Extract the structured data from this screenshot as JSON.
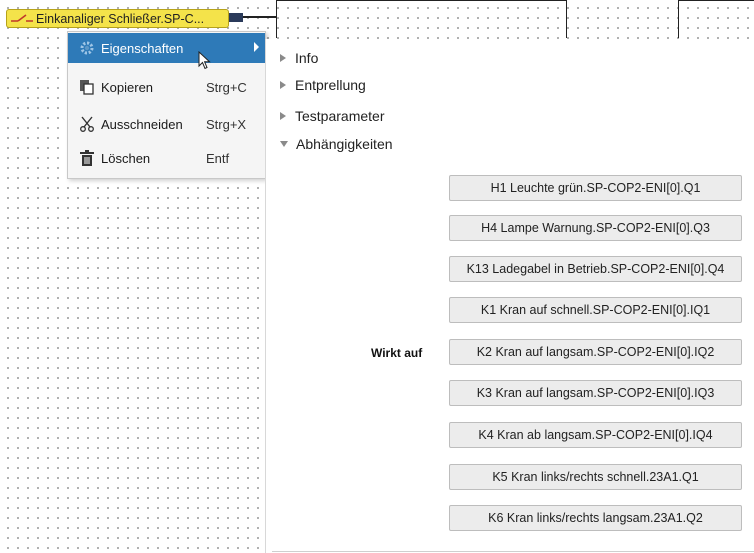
{
  "canvas": {
    "block_label": "Einkanaliger Schließer.SP-C...",
    "block_color": "#f4e34a"
  },
  "context_menu": {
    "items": [
      {
        "label": "Eigenschaften",
        "shortcut": "",
        "icon": "gear-icon",
        "highlighted": true,
        "submenu": true
      },
      {
        "label": "Kopieren",
        "shortcut": "Strg+C",
        "icon": "copy-icon"
      },
      {
        "label": "Ausschneiden",
        "shortcut": "Strg+X",
        "icon": "scissors-icon"
      },
      {
        "label": "Löschen",
        "shortcut": "Entf",
        "icon": "trash-icon"
      }
    ],
    "highlight_color": "#2e7ab8"
  },
  "properties": {
    "sections": [
      {
        "label": "Info",
        "expanded": false
      },
      {
        "label": "Entprellung",
        "expanded": false
      },
      {
        "label": "Testparameter",
        "expanded": false
      },
      {
        "label": "Abhängigkeiten",
        "expanded": true
      }
    ],
    "dependency_label": "Wirkt auf",
    "dependencies": [
      "H1 Leuchte grün.SP-COP2-ENI[0].Q1",
      "H4 Lampe Warnung.SP-COP2-ENI[0].Q3",
      "K13 Ladegabel in Betrieb.SP-COP2-ENI[0].Q4",
      "K1 Kran auf schnell.SP-COP2-ENI[0].IQ1",
      "K2 Kran auf langsam.SP-COP2-ENI[0].IQ2",
      "K3 Kran auf langsam.SP-COP2-ENI[0].IQ3",
      "K4 Kran ab langsam.SP-COP2-ENI[0].IQ4",
      "K5 Kran links/rechts schnell.23A1.Q1",
      "K6 Kran links/rechts langsam.23A1.Q2"
    ]
  }
}
